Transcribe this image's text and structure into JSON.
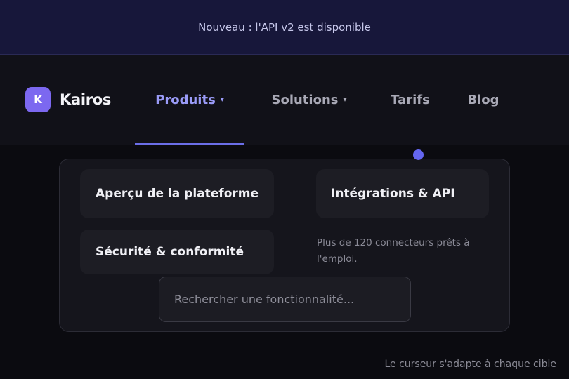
{
  "announcement": {
    "text": "Nouveau : l'API v2 est disponible"
  },
  "brand": {
    "mark": "K",
    "name": "Kairos"
  },
  "nav": {
    "items": [
      {
        "label": "Produits",
        "caret": "▾"
      },
      {
        "label": "Solutions",
        "caret": "▾"
      },
      {
        "label": "Tarifs"
      },
      {
        "label": "Blog"
      }
    ],
    "active": "Produits"
  },
  "menu": {
    "cards": [
      {
        "label": "Aperçu de la plateforme"
      },
      {
        "label": "Sécurité & conformité"
      },
      {
        "label": "Intégrations & API"
      }
    ],
    "description": "Plus de 120 connecteurs prêts à l'emploi."
  },
  "search": {
    "placeholder": "Rechercher une fonctionnalité..."
  },
  "hint": "Le curseur s'adapte à chaque cible",
  "colors": {
    "accent": "#7c68f0",
    "nav_active": "#9a9bf7",
    "cursor_dot": "#6466f0",
    "background": "#0b0b10",
    "announcement_bg": "#17173a"
  }
}
